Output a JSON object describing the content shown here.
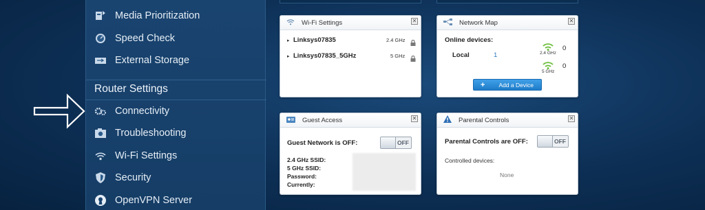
{
  "sidebar": {
    "items_top": [
      {
        "label": "Media Prioritization",
        "icon": "media-prioritization-icon"
      },
      {
        "label": "Speed Check",
        "icon": "speed-check-icon"
      },
      {
        "label": "External Storage",
        "icon": "usb-storage-icon"
      }
    ],
    "section_title": "Router Settings",
    "items_router": [
      {
        "label": "Connectivity",
        "icon": "gear-icon"
      },
      {
        "label": "Troubleshooting",
        "icon": "camera-icon"
      },
      {
        "label": "Wi-Fi Settings",
        "icon": "wifi-icon"
      },
      {
        "label": "Security",
        "icon": "shield-icon"
      },
      {
        "label": "OpenVPN Server",
        "icon": "openvpn-icon"
      }
    ]
  },
  "wifi_widget": {
    "title": "Wi-Fi Settings",
    "networks": [
      {
        "name": "Linksys07835",
        "band": "2.4 GHz"
      },
      {
        "name": "Linksys07835_5GHz",
        "band": "5 GHz"
      }
    ]
  },
  "network_map": {
    "title": "Network Map",
    "online_label": "Online devices:",
    "local_label": "Local",
    "local_count": "1",
    "band1": "2.4 GHz",
    "band1_count": "0",
    "band2": "5 GHz",
    "band2_count": "0",
    "add_button": "Add a Device"
  },
  "guest_access": {
    "title": "Guest Access",
    "status": "Guest Network is OFF:",
    "toggle": "OFF",
    "ssid24": "2.4 GHz SSID:",
    "ssid5": "5 GHz SSID:",
    "password": "Password:",
    "currently": "Currently:"
  },
  "parental": {
    "title": "Parental Controls",
    "status": "Parental Controls are OFF:",
    "toggle": "OFF",
    "controlled": "Controlled devices:",
    "none": "None"
  },
  "colors": {
    "accent": "#2c8bd6",
    "wifi_green": "#6abf3a"
  }
}
